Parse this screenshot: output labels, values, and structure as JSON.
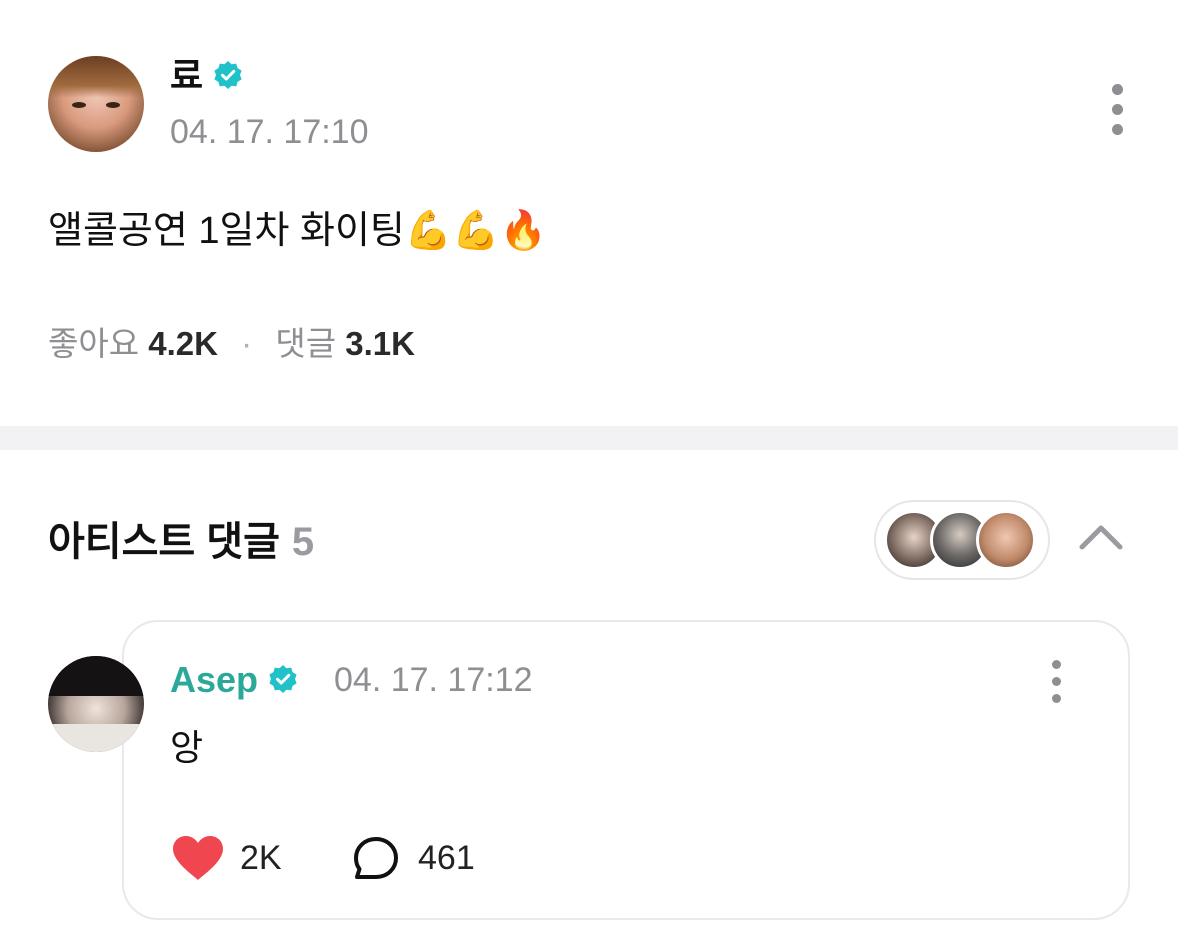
{
  "post": {
    "author": "료",
    "timestamp": "04. 17. 17:10",
    "text": "앨콜공연 1일차 화이팅💪💪🔥",
    "likes_label": "좋아요",
    "likes_count": "4.2K",
    "comments_label": "댓글",
    "comments_count": "3.1K",
    "verified": true
  },
  "artist_comments": {
    "title": "아티스트 댓글",
    "count": "5",
    "comments": [
      {
        "author": "Asep",
        "timestamp": "04. 17. 17:12",
        "text": "앙",
        "likes": "2K",
        "replies": "461",
        "verified": true
      }
    ]
  },
  "colors": {
    "verified": "#20c1c9",
    "artist_name": "#2aa89a",
    "heart": "#f0464f",
    "muted_text": "#8e8e93",
    "divider": "#f2f2f4"
  },
  "icons": [
    "verified-badge-icon",
    "more-vertical-icon",
    "chevron-up-icon",
    "heart-icon",
    "reply-bubble-icon"
  ]
}
